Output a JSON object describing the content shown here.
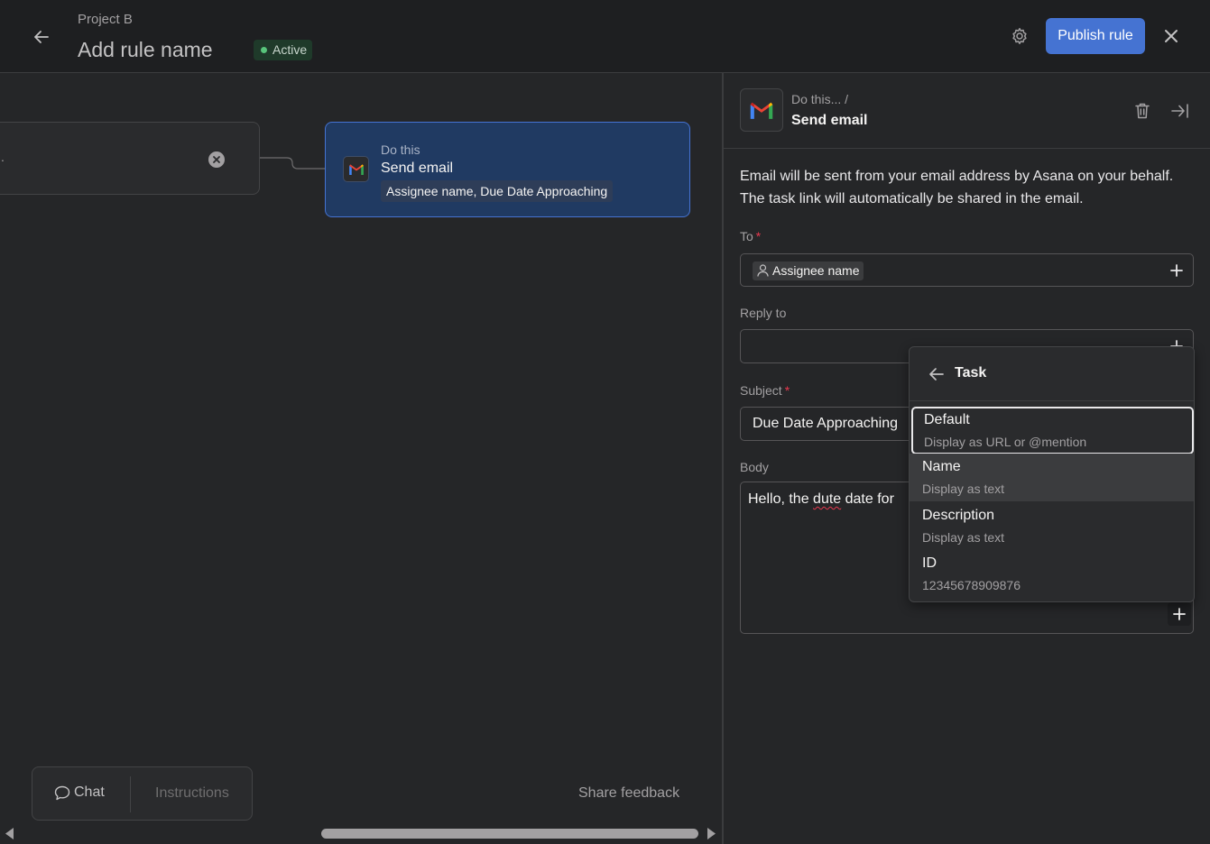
{
  "header": {
    "project": "Project B",
    "rule_name": "Add rule name",
    "status": "Active",
    "publish_label": "Publish rule"
  },
  "canvas": {
    "trigger_text": ".",
    "action": {
      "subtitle": "Do this",
      "title": "Send email",
      "chip": "Assignee name, Due Date Approaching"
    },
    "bottom": {
      "chat_label": "Chat",
      "instructions_label": "Instructions",
      "share_feedback_label": "Share feedback"
    }
  },
  "panel": {
    "breadcrumb": "Do this...  /",
    "title": "Send email",
    "description": "Email will be sent from your email address by Asana on your behalf. The task link will automatically be shared in the email.",
    "to_label": "To",
    "to_chip": "Assignee name",
    "reply_label": "Reply to",
    "subject_label": "Subject",
    "subject_value": "Due Date Approaching",
    "body_label": "Body",
    "body_pre": "Hello, the ",
    "body_misspelled": "dute",
    "body_post": " date for",
    "required_mark": "*"
  },
  "dropdown": {
    "title": "Task",
    "items": [
      {
        "label": "Default",
        "sub": "Display as URL or @mention"
      },
      {
        "label": "Name",
        "sub": "Display as text"
      },
      {
        "label": "Description",
        "sub": "Display as text"
      },
      {
        "label": "ID",
        "sub": "12345678909876"
      }
    ]
  },
  "icons": {
    "back": "arrow-left-icon",
    "settings": "gear-icon",
    "close": "close-icon",
    "gmail": "gmail-icon",
    "trash": "trash-icon",
    "collapse": "collapse-panel-icon",
    "add": "plus-icon",
    "person": "person-icon",
    "chat": "chat-bubble-icon"
  },
  "colors": {
    "accent": "#4573d2",
    "status_green": "#58c47b",
    "required_red": "#e8384f",
    "action_card_bg": "#203a62"
  }
}
